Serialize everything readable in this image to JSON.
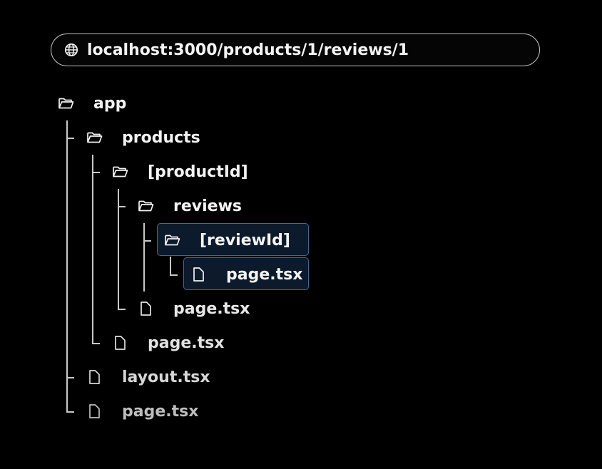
{
  "url_bar": {
    "url": "localhost:3000/products/1/reviews/1",
    "icon": "globe-icon"
  },
  "colors": {
    "background": "#000000",
    "text": "#f2f2f2",
    "muted_text": "#c4c4c4",
    "line": "#c8c8c8",
    "highlight_border": "#3f6a93",
    "highlight_fill": "#0c1a2b"
  },
  "tree": {
    "app": {
      "label": "app",
      "icon": "folder-icon"
    },
    "products": {
      "label": "products",
      "icon": "folder-icon"
    },
    "product_id": {
      "label": "[productId]",
      "icon": "folder-icon"
    },
    "reviews": {
      "label": "reviews",
      "icon": "folder-icon"
    },
    "review_id": {
      "label": "[reviewId]",
      "icon": "folder-icon",
      "highlighted": true
    },
    "review_page": {
      "label": "page.tsx",
      "icon": "file-icon",
      "highlighted": true
    },
    "product_page": {
      "label": "page.tsx",
      "icon": "file-icon"
    },
    "products_page": {
      "label": "page.tsx",
      "icon": "file-icon"
    },
    "layout": {
      "label": "layout.tsx",
      "icon": "file-icon"
    },
    "root_page": {
      "label": "page.tsx",
      "icon": "file-icon"
    }
  }
}
